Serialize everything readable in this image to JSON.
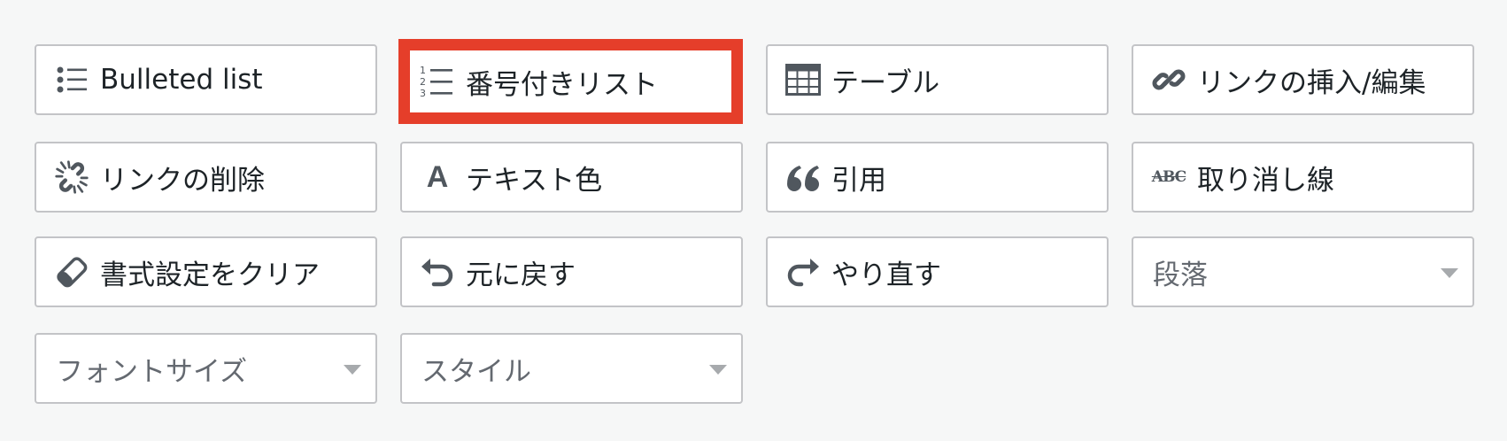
{
  "toolbar": {
    "bulleted_list": {
      "label": "Bulleted list",
      "icon": "list-bullets-icon"
    },
    "numbered_list": {
      "label": "番号付きリスト",
      "icon": "list-numbers-icon",
      "highlight_color": "#e53e2a"
    },
    "table": {
      "label": "テーブル",
      "icon": "table-icon"
    },
    "insert_link": {
      "label": "リンクの挿入/編集",
      "icon": "link-icon"
    },
    "remove_link": {
      "label": "リンクの削除",
      "icon": "unlink-icon"
    },
    "text_color": {
      "label": "テキスト色",
      "icon": "text-color-icon",
      "icon_glyph": "A"
    },
    "blockquote": {
      "label": "引用",
      "icon": "quote-icon"
    },
    "strikethrough": {
      "label": "取り消し線",
      "icon": "strikethrough-icon",
      "icon_glyph": "ABC"
    },
    "clear_formatting": {
      "label": "書式設定をクリア",
      "icon": "eraser-icon"
    },
    "undo": {
      "label": "元に戻す",
      "icon": "undo-icon"
    },
    "redo": {
      "label": "やり直す",
      "icon": "redo-icon"
    },
    "format_select": {
      "value": "段落"
    },
    "font_size_select": {
      "value": "フォントサイズ"
    },
    "style_select": {
      "value": "スタイル"
    }
  },
  "colors": {
    "background": "#f6f7f7",
    "button_border": "#c3c4c7",
    "highlight": "#e53e2a",
    "icon": "#50575e"
  }
}
